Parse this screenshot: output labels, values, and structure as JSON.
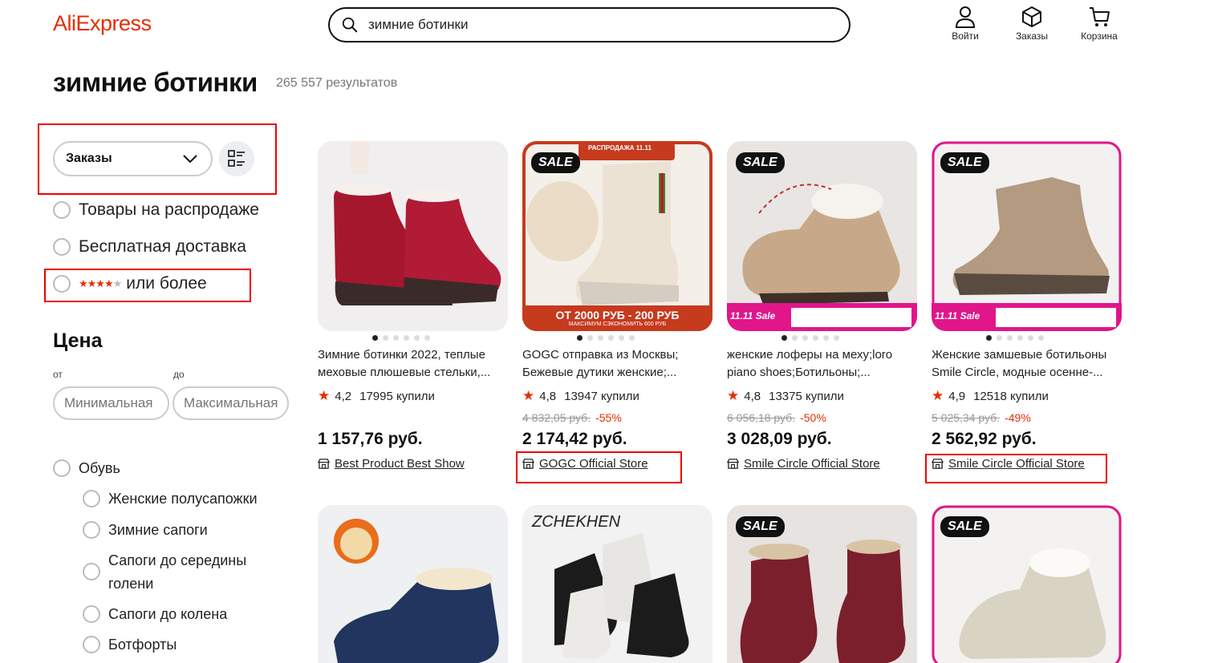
{
  "header": {
    "logo": "AliExpress",
    "search_value": "зимние ботинки",
    "login_label": "Войти",
    "orders_label": "Заказы",
    "cart_label": "Корзина"
  },
  "page": {
    "title": "зимние ботинки",
    "results": "265 557 результатов"
  },
  "sidebar": {
    "sort_value": "Заказы",
    "filters": {
      "sale": "Товары на распродаже",
      "free_shipping": "Бесплатная доставка",
      "rating": "или более",
      "rating_stars": 4
    },
    "price": {
      "title": "Цена",
      "from_label": "от",
      "to_label": "до",
      "min_placeholder": "Минимальная",
      "max_placeholder": "Максимальная"
    },
    "categories": {
      "root": "Обувь",
      "items": [
        "Женские полусапожки",
        "Зимние сапоги",
        "Сапоги до середины голени",
        "Сапоги до колена",
        "Ботфорты"
      ]
    }
  },
  "products": [
    {
      "name": "Зимние ботинки 2022, теплые меховые плюшевые стельки,...",
      "rating": "4,2",
      "sold": "17995 купили",
      "old_price": "",
      "discount": "",
      "price": "1 157,76 руб.",
      "store": "Best Product Best Show",
      "sale_badge": ""
    },
    {
      "name": "GOGC отправка из Москвы; Бежевые дутики женские;...",
      "rating": "4,8",
      "sold": "13947 купили",
      "old_price": "4 832,05 руб.",
      "discount": "-55%",
      "price": "2 174,42 руб.",
      "store": "GOGC Official Store",
      "sale_badge": "SALE",
      "promo_top": "РАСПРОДАЖА 11.11",
      "promo_bottom": "ОТ 2000 РУБ - 200 РУБ",
      "promo_sub": "МАКСИМУМ СЭКОНОМИТЬ 600 РУБ"
    },
    {
      "name": "женские лоферы на меху;loro piano shoes;Ботильоны;...",
      "rating": "4,8",
      "sold": "13375 купили",
      "old_price": "6 056,18 руб.",
      "discount": "-50%",
      "price": "3 028,09 руб.",
      "store": "Smile Circle Official Store",
      "sale_badge": "SALE",
      "promo_bottom": "11.11 Sale"
    },
    {
      "name": "Женские замшевые ботильоны Smile Circle, модные осенне-...",
      "rating": "4,9",
      "sold": "12518 купили",
      "old_price": "5 025,34 руб.",
      "discount": "-49%",
      "price": "2 562,92 руб.",
      "store": "Smile Circle Official Store",
      "sale_badge": "SALE",
      "promo_bottom": "11.11 Sale"
    }
  ],
  "products_row2": [
    {
      "sale_badge": ""
    },
    {
      "sale_badge": "",
      "brand": "ZCHEKHEN"
    },
    {
      "sale_badge": "SALE"
    },
    {
      "sale_badge": "SALE"
    }
  ],
  "colors": {
    "brand": "#e62e04",
    "highlight_box": "#ee0000"
  }
}
